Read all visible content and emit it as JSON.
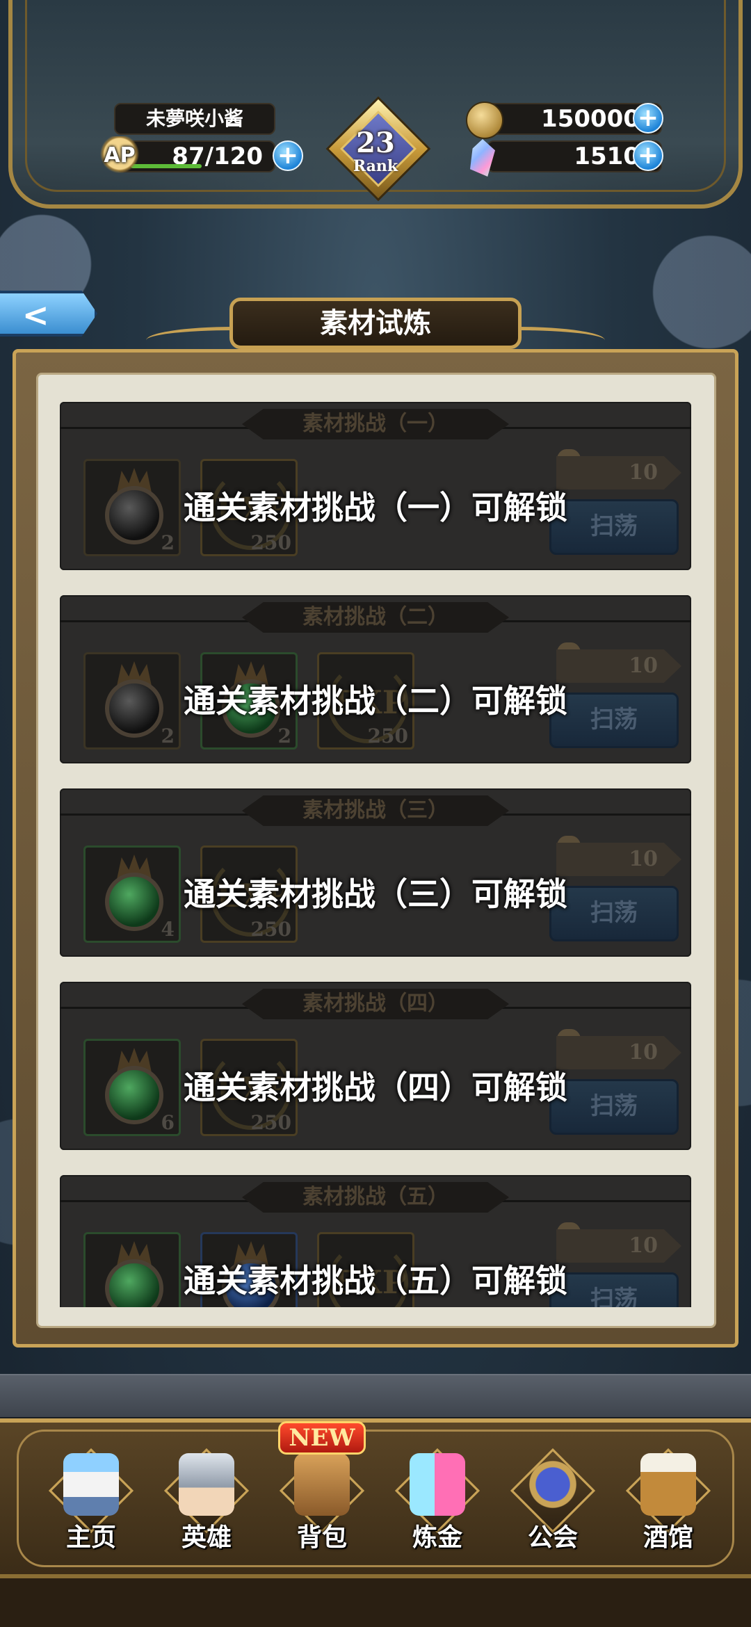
{
  "header": {
    "player_name": "未夢咲小酱",
    "ap_label": "AP",
    "ap_value": "87/120",
    "ap_fraction": 0.725,
    "rank_number": "23",
    "rank_label": "Rank",
    "gold": "150000",
    "gems": "1510",
    "plus": "+"
  },
  "back_glyph": "<",
  "page_title": "素材试炼",
  "stages": [
    {
      "header": "素材挑战（一）",
      "lock_text": "通关素材挑战（一）可解锁",
      "stamina": "10",
      "sweep_label": "扫荡",
      "rewards": [
        {
          "type": "black-orb",
          "qty": "2"
        },
        {
          "type": "exp",
          "qty": "250",
          "text": "EXP"
        }
      ]
    },
    {
      "header": "素材挑战（二）",
      "lock_text": "通关素材挑战（二）可解锁",
      "stamina": "10",
      "sweep_label": "扫荡",
      "rewards": [
        {
          "type": "black-orb",
          "qty": "2"
        },
        {
          "type": "green-orb",
          "qty": "2"
        },
        {
          "type": "exp",
          "qty": "250",
          "text": "EXP"
        }
      ]
    },
    {
      "header": "素材挑战（三）",
      "lock_text": "通关素材挑战（三）可解锁",
      "stamina": "10",
      "sweep_label": "扫荡",
      "rewards": [
        {
          "type": "green-orb",
          "qty": "4"
        },
        {
          "type": "exp",
          "qty": "250",
          "text": "EXP"
        }
      ]
    },
    {
      "header": "素材挑战（四）",
      "lock_text": "通关素材挑战（四）可解锁",
      "stamina": "10",
      "sweep_label": "扫荡",
      "rewards": [
        {
          "type": "green-orb",
          "qty": "6"
        },
        {
          "type": "exp",
          "qty": "250",
          "text": "EXP"
        }
      ]
    },
    {
      "header": "素材挑战（五）",
      "lock_text": "通关素材挑战（五）可解锁",
      "stamina": "10",
      "sweep_label": "扫荡",
      "rewards": [
        {
          "type": "green-orb",
          "qty": ""
        },
        {
          "type": "blue-orb",
          "qty": ""
        },
        {
          "type": "exp",
          "qty": "",
          "text": "EXP"
        }
      ]
    }
  ],
  "nav": {
    "new_badge": "NEW",
    "items": [
      {
        "label": "主页",
        "icon": "castle-icon"
      },
      {
        "label": "英雄",
        "icon": "knight-helmet-icon"
      },
      {
        "label": "背包",
        "icon": "backpack-icon"
      },
      {
        "label": "炼金",
        "icon": "potion-flasks-icon"
      },
      {
        "label": "公会",
        "icon": "guild-shield-icon"
      },
      {
        "label": "酒馆",
        "icon": "tavern-mug-icon"
      }
    ]
  },
  "colors": {
    "gold_trim": "#c9a357",
    "panel_bg": "#e4e1d3",
    "card_bg": "#2c2b2a",
    "ap_bar": "#5dbb38"
  }
}
